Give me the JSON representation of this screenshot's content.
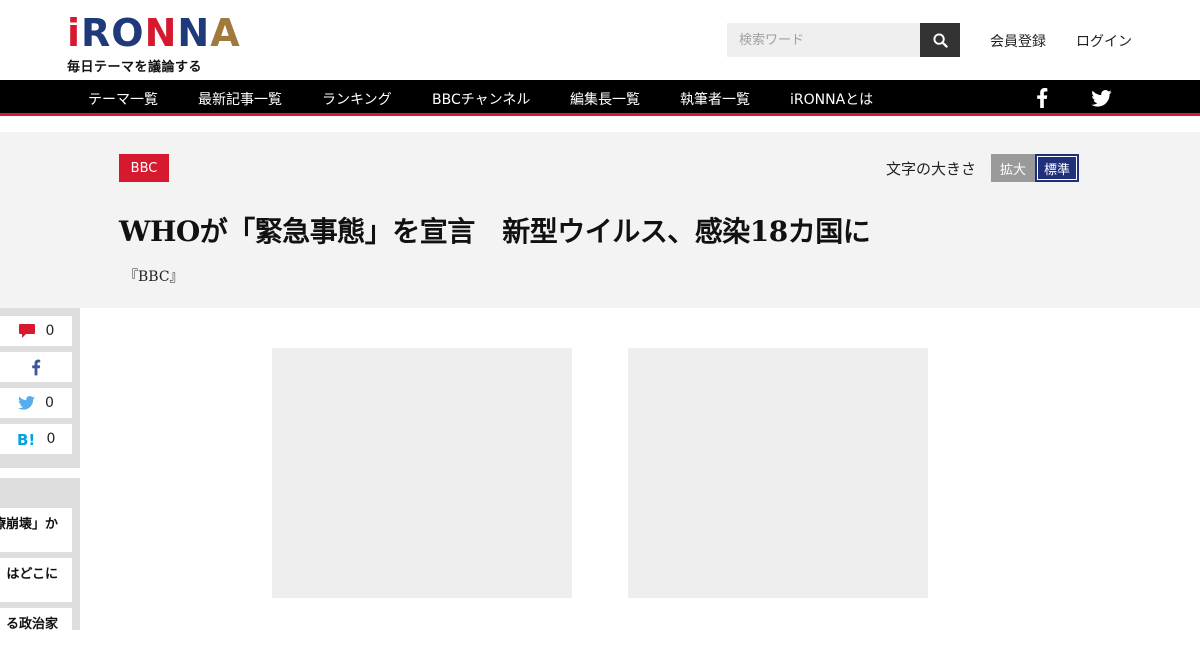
{
  "logo": {
    "letters": [
      "i",
      "R",
      "O",
      "N",
      "N",
      "A"
    ],
    "tagline": "毎日テーマを議論する"
  },
  "header": {
    "search_placeholder": "検索ワード",
    "register": "会員登録",
    "login": "ログイン"
  },
  "nav": {
    "items": [
      "テーマ一覧",
      "最新記事一覧",
      "ランキング",
      "BBCチャンネル",
      "編集長一覧",
      "執筆者一覧",
      "iRONNAとは"
    ]
  },
  "article": {
    "category": "BBC",
    "font_size_label": "文字の大きさ",
    "font_large": "拡大",
    "font_standard": "標準",
    "title": "WHOが「緊急事態」を宣言　新型ウイルス、感染18カ国に",
    "source": "『BBC』"
  },
  "share": {
    "comments": "0",
    "twitter": "0",
    "hatena": "0"
  },
  "related": [
    "療崩壊」か",
    "はどこに",
    "る政治家"
  ],
  "colors": {
    "brand_red": "#d7192f",
    "brand_blue": "#1e3a7a",
    "brand_gold": "#a07a3c",
    "nav_bg": "#000000"
  }
}
